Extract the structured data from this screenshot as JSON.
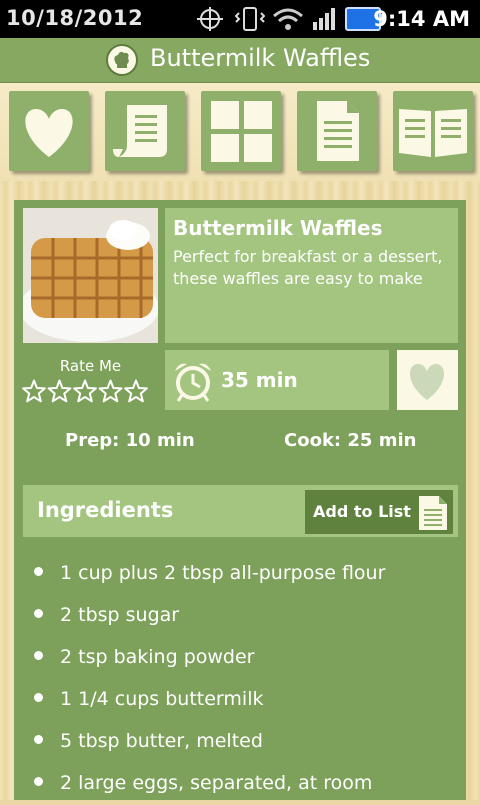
{
  "status_bar": {
    "date": "10/18/2012",
    "time": "9:14 AM"
  },
  "app_bar": {
    "title": "Buttermilk Waffles"
  },
  "toolbar": {
    "icons": [
      "heart-icon",
      "scroll-icon",
      "grid-icon",
      "document-icon",
      "book-icon"
    ]
  },
  "recipe": {
    "name": "Buttermilk Waffles",
    "description": "Perfect for breakfast or a dessert, these waffles are easy to make",
    "rate_label": "Rate Me",
    "rating": 0,
    "rating_max": 5,
    "total_time": "35 min",
    "prep": "Prep: 10 min",
    "cook": "Cook: 25 min"
  },
  "ingredients": {
    "header": "Ingredients",
    "add_to_list": "Add to List",
    "items": [
      "1 cup plus 2 tbsp all-purpose flour",
      "2 tbsp sugar",
      "2 tsp baking powder",
      "1 1/4 cups buttermilk",
      "5 tbsp butter, melted",
      "2 large eggs, separated, at room"
    ]
  },
  "colors": {
    "primary_green": "#7da05a",
    "light_green": "#a3c57f",
    "dark_green": "#5f823e",
    "title_green": "#86a861"
  }
}
